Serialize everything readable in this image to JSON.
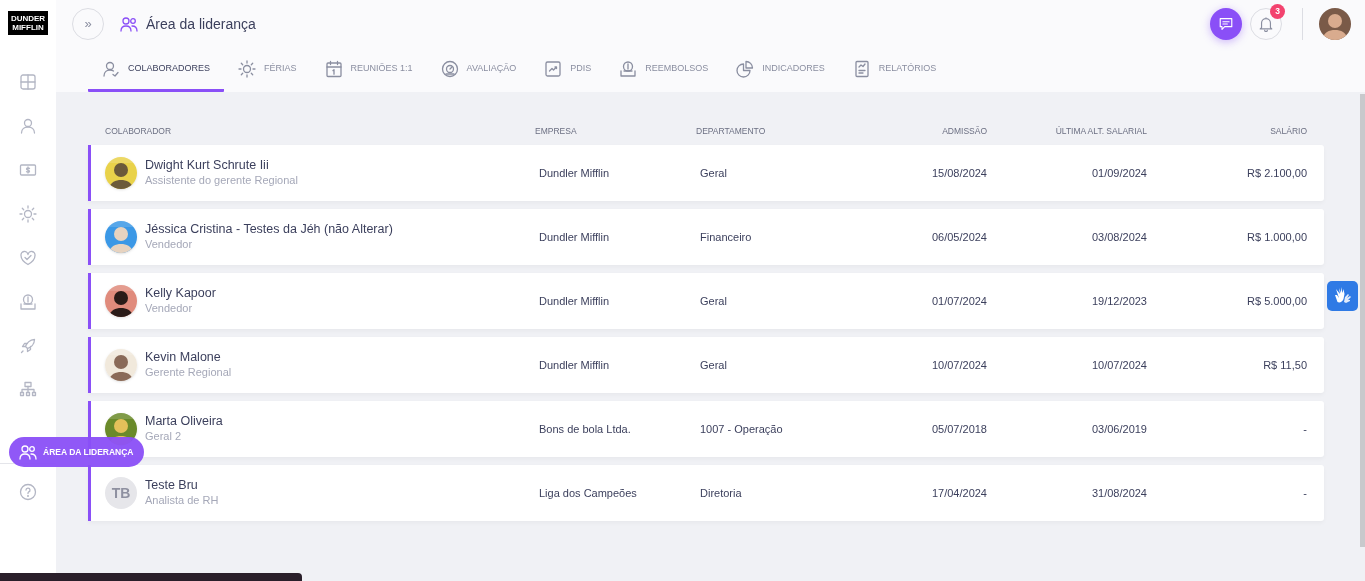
{
  "logo": {
    "line_1": "DUNDER",
    "line_2": "MIFFLIN"
  },
  "header": {
    "expand_symbol": "»",
    "title": "Área da liderança",
    "notifications": "3"
  },
  "tabs": [
    {
      "label": "COLABORADORES",
      "selected": true
    },
    {
      "label": "FÉRIAS",
      "selected": false
    },
    {
      "label": "REUNIÕES 1:1",
      "selected": false
    },
    {
      "label": "AVALIAÇÃO",
      "selected": false
    },
    {
      "label": "PDIS",
      "selected": false
    },
    {
      "label": "REEMBOLSOS",
      "selected": false
    },
    {
      "label": "INDICADORES",
      "selected": false
    },
    {
      "label": "RELATÓRIOS",
      "selected": false
    }
  ],
  "sidebar": {
    "tooltip": "ÁREA DA LIDERANÇA"
  },
  "table": {
    "columns": [
      "COLABORADOR",
      "EMPRESA",
      "DEPARTAMENTO",
      "ADMISSÃO",
      "ÚLTIMA ALT. SALARIAL",
      "SALÁRIO"
    ],
    "rows": [
      {
        "name": "Dwight Kurt Schrute Iii",
        "role": "Assistente do gerente Regional",
        "company": "Dundler Mifflin",
        "department": "Geral",
        "admission": "15/08/2024",
        "last_change": "01/09/2024",
        "salary": "R$ 2.100,00"
      },
      {
        "name": "Jéssica Cristina - Testes da Jéh (não Alterar)",
        "role": "Vendedor",
        "company": "Dundler Mifflin",
        "department": "Financeiro",
        "admission": "06/05/2024",
        "last_change": "03/08/2024",
        "salary": "R$ 1.000,00"
      },
      {
        "name": "Kelly Kapoor",
        "role": "Vendedor",
        "company": "Dundler Mifflin",
        "department": "Geral",
        "admission": "01/07/2024",
        "last_change": "19/12/2023",
        "salary": "R$ 5.000,00"
      },
      {
        "name": "Kevin Malone",
        "role": "Gerente Regional",
        "company": "Dundler Mifflin",
        "department": "Geral",
        "admission": "10/07/2024",
        "last_change": "10/07/2024",
        "salary": "R$ 11,50"
      },
      {
        "name": "Marta Oliveira",
        "role": "Geral 2",
        "company": "Bons de bola Ltda.",
        "department": "1007 - Operação",
        "admission": "05/07/2018",
        "last_change": "03/06/2019",
        "salary": "-"
      },
      {
        "name": "Teste Bru",
        "role": "Analista de RH",
        "avatar": {
          "kind": "initials",
          "initials": "TB"
        },
        "company": "Liga dos Campeões",
        "department": "Diretoria",
        "admission": "17/04/2024",
        "last_change": "31/08/2024",
        "salary": "-"
      }
    ]
  }
}
